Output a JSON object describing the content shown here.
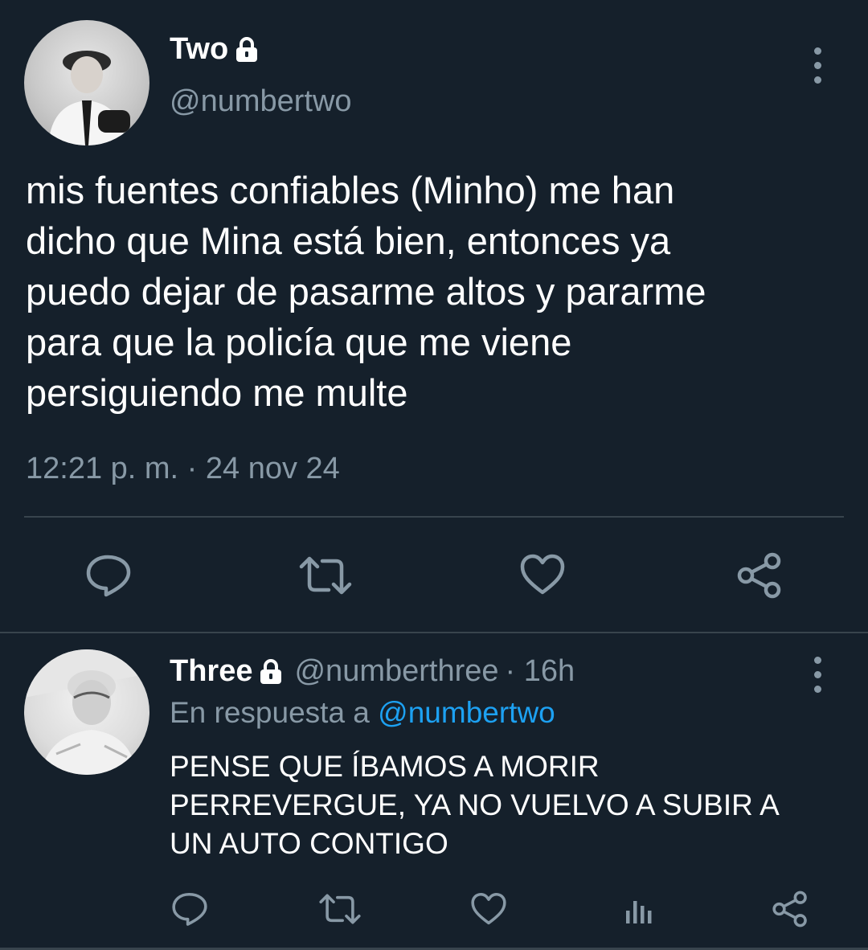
{
  "main_tweet": {
    "display_name": "Two",
    "handle": "@numbertwo",
    "text": "mis fuentes confiables (Minho) me han\ndicho que Mina está bien, entonces ya\npuedo dejar de pasarme altos y pararme\npara que la policía que me viene\npersiguiendo me multe",
    "timestamp": "12:21 p. m. · 24 nov 24",
    "actions": [
      "reply-icon",
      "retweet-icon",
      "like-icon",
      "share-icon"
    ]
  },
  "reply_tweet": {
    "display_name": "Three",
    "handle": "@numberthree",
    "time": "· 16h",
    "reply_prefix": "En respuesta a",
    "reply_to": "@numbertwo",
    "text": "PENSE QUE ÍBAMOS A MORIR\nPERREVERGUE, YA NO VUELVO A SUBIR A\nUN AUTO CONTIGO",
    "actions": [
      "reply-icon",
      "retweet-icon",
      "like-icon",
      "analytics-icon",
      "share-icon"
    ]
  },
  "colors": {
    "background": "#15202b",
    "text": "#ffffff",
    "secondary": "#8899a6",
    "link": "#1da1f2",
    "divider": "#38444d"
  }
}
